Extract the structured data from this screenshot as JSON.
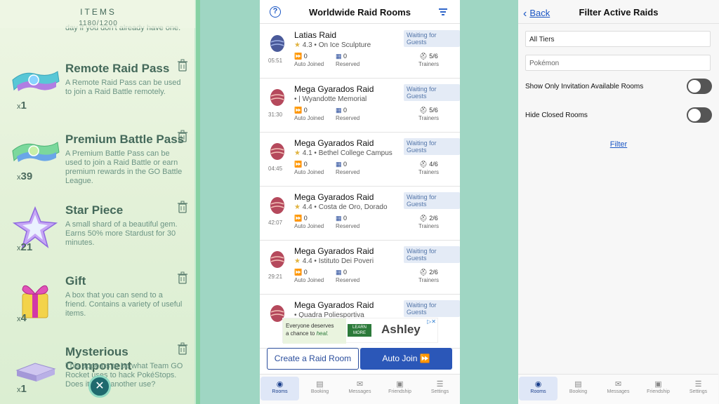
{
  "left_panel": {
    "header": "ITEMS",
    "count": "1180/1200",
    "prev_desc": "day if you don't already have one.",
    "items": [
      {
        "name": "Remote Raid Pass",
        "desc": "A Remote Raid Pass can be used to join a Raid Battle remotely.",
        "qty": "1",
        "icon": "remote-raid-pass-icon"
      },
      {
        "name": "Premium Battle Pass",
        "desc": "A Premium Battle Pass can be used to join a Raid Battle or earn premium rewards in the GO Battle League.",
        "qty": "39",
        "icon": "premium-battle-pass-icon"
      },
      {
        "name": "Star Piece",
        "desc": "A small shard of a beautiful gem. Earns 50% more Stardust for 30 minutes.",
        "qty": "21",
        "icon": "star-piece-icon"
      },
      {
        "name": "Gift",
        "desc": "A box that you can send to a friend. Contains a variety of useful items.",
        "qty": "4",
        "icon": "gift-icon"
      },
      {
        "name": "Mysterious Component",
        "desc": "This appears to be what Team GO Rocket uses to hack PokéStops. Does it have another use?",
        "qty": "1",
        "icon": "mysterious-component-icon"
      }
    ],
    "qty_prefix": "x",
    "close": "✕"
  },
  "middle_panel": {
    "title": "Worldwide Raid Rooms",
    "help": "?",
    "rooms": [
      {
        "name": "Latias Raid",
        "rating": "4.3",
        "location": "On Ice Sculpture",
        "time": "05:51",
        "status": "Waiting for Guests",
        "auto_joined": "0",
        "reserved": "0",
        "trainers": "5/6",
        "egg": "legendary"
      },
      {
        "name": "Mega Gyarados Raid",
        "rating": "",
        "location": "| Wyandotte Memorial",
        "time": "31:30",
        "status": "Waiting for Guests",
        "auto_joined": "0",
        "reserved": "0",
        "trainers": "5/6",
        "egg": "mega"
      },
      {
        "name": "Mega Gyarados Raid",
        "rating": "4.1",
        "location": "Bethel College Campus",
        "time": "04:45",
        "status": "Waiting for Guests",
        "auto_joined": "0",
        "reserved": "0",
        "trainers": "4/6",
        "egg": "mega"
      },
      {
        "name": "Mega Gyarados Raid",
        "rating": "4.4",
        "location": "Costa de Oro, Dorado",
        "time": "42:07",
        "status": "Waiting for Guests",
        "auto_joined": "0",
        "reserved": "0",
        "trainers": "2/6",
        "egg": "mega"
      },
      {
        "name": "Mega Gyarados Raid",
        "rating": "4.4",
        "location": "Istituto Dei Poveri",
        "time": "29:21",
        "status": "Waiting for Guests",
        "auto_joined": "0",
        "reserved": "0",
        "trainers": "2/6",
        "egg": "mega"
      },
      {
        "name": "Mega Gyarados Raid",
        "rating": "",
        "location": "Quadra Poliesportiva",
        "time": "",
        "status": "Waiting for Guests",
        "auto_joined": "",
        "reserved": "",
        "trainers": "",
        "egg": "mega"
      }
    ],
    "labels": {
      "auto_joined": "Auto Joined",
      "reserved": "Reserved",
      "trainers": "Trainers"
    },
    "ad": {
      "line1": "Everyone deserves",
      "line2": "a chance to",
      "line2_em": "heal.",
      "learn": "LEARN MORE",
      "brand": "Ashley"
    },
    "create_button": "Create a Raid Room",
    "auto_join_button": "Auto Join",
    "tabs": [
      "Rooms",
      "Booking",
      "Messages",
      "Friendship",
      "Settings"
    ]
  },
  "right_panel": {
    "back": "Back",
    "title": "Filter Active Raids",
    "tier_value": "All Tiers",
    "pokemon_placeholder": "Pokémon",
    "toggle1_label": "Show Only Invitation Available Rooms",
    "toggle2_label": "Hide Closed Rooms",
    "toggle1_on": false,
    "toggle2_on": false,
    "filter_link": "Filter",
    "tabs": [
      "Rooms",
      "Booking",
      "Messages",
      "Friendship",
      "Settings"
    ]
  },
  "colors": {
    "accent": "#2b57b8",
    "link": "#1a56c4",
    "item_text": "#44695a",
    "badge_bg": "#e4ebf6"
  }
}
